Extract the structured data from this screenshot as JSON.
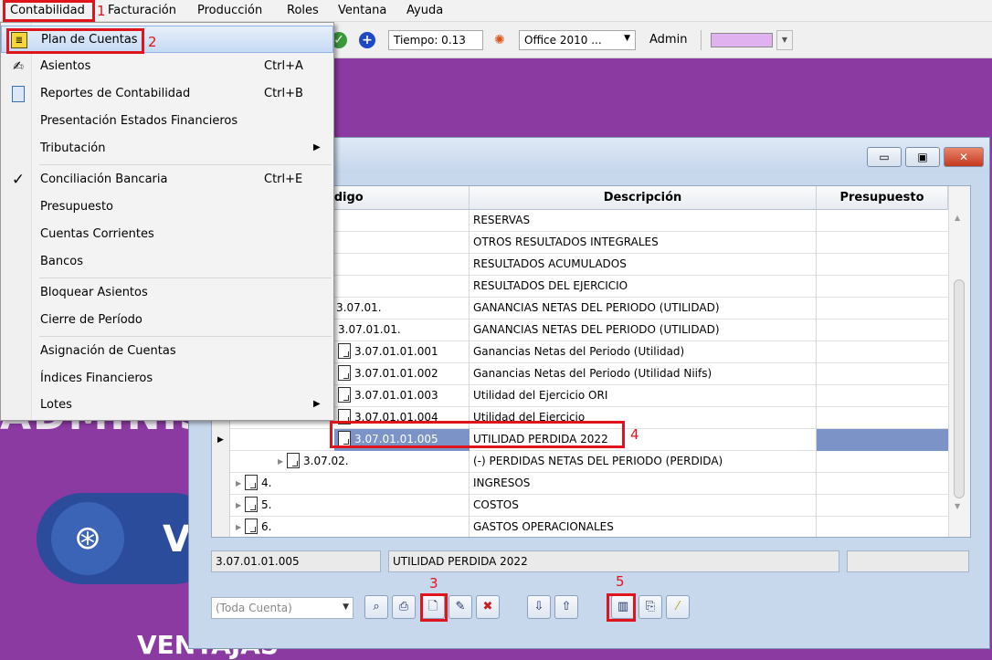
{
  "menubar": {
    "items": [
      "Contabilidad",
      "Facturación",
      "Producción",
      "Roles",
      "Ventana",
      "Ayuda"
    ]
  },
  "toolbar": {
    "tiempo": "Tiempo: 0.13",
    "theme": "Office 2010 ...",
    "user": "Admin"
  },
  "background": {
    "watermark": "ADMINIS",
    "pill_letter": "V",
    "bottom_text": "VENTAJAS"
  },
  "menu": {
    "items": [
      {
        "label": "Plan de Cuentas",
        "shortcut": "",
        "icon": "ledger-icon"
      },
      {
        "label": "Asientos",
        "shortcut": "Ctrl+A",
        "icon": "journal-icon"
      },
      {
        "label": "Reportes de Contabilidad",
        "shortcut": "Ctrl+B",
        "icon": "report-icon"
      },
      {
        "label": "Presentación Estados Financieros",
        "shortcut": ""
      },
      {
        "label": "Tributación",
        "shortcut": "",
        "submenu": true
      },
      {
        "label": "Conciliación Bancaria",
        "shortcut": "Ctrl+E",
        "checked": true
      },
      {
        "label": "Presupuesto",
        "shortcut": ""
      },
      {
        "label": "Cuentas Corrientes",
        "shortcut": ""
      },
      {
        "label": "Bancos",
        "shortcut": ""
      },
      {
        "label": "Bloquear Asientos",
        "shortcut": ""
      },
      {
        "label": "Cierre de Período",
        "shortcut": ""
      },
      {
        "label": "Asignación de Cuentas",
        "shortcut": ""
      },
      {
        "label": "Índices Financieros",
        "shortcut": ""
      },
      {
        "label": "Lotes",
        "shortcut": "",
        "submenu": true
      }
    ]
  },
  "grid": {
    "headers": [
      "Código",
      "Descripción",
      "Presupuesto"
    ],
    "rows": [
      {
        "code": "",
        "desc": "RESERVAS"
      },
      {
        "code": "",
        "desc": "OTROS RESULTADOS INTEGRALES"
      },
      {
        "code": "",
        "desc": "RESULTADOS ACUMULADOS"
      },
      {
        "code": "",
        "desc": "RESULTADOS DEL EJERCICIO"
      },
      {
        "code": "3.07.01.",
        "desc": "GANANCIAS NETAS DEL PERIODO (UTILIDAD)"
      },
      {
        "code": "3.07.01.01.",
        "desc": "GANANCIAS NETAS DEL PERIODO (UTILIDAD)"
      },
      {
        "code": "3.07.01.01.001",
        "desc": "Ganancias Netas del Periodo (Utilidad)"
      },
      {
        "code": "3.07.01.01.002",
        "desc": "Ganancias Netas del Periodo (Utilidad Niifs)"
      },
      {
        "code": "3.07.01.01.003",
        "desc": "Utilidad del Ejercicio ORI"
      },
      {
        "code": "3.07.01.01.004",
        "desc": "Utilidad del Ejercicio"
      },
      {
        "code": "3.07.01.01.005",
        "desc": "UTILIDAD PERDIDA 2022"
      },
      {
        "code": "3.07.02.",
        "desc": "(-) PERDIDAS NETAS DEL PERIODO (PERDIDA)"
      },
      {
        "code": "4.",
        "desc": "INGRESOS"
      },
      {
        "code": "5.",
        "desc": "COSTOS"
      },
      {
        "code": "6.",
        "desc": "GASTOS  OPERACIONALES"
      }
    ]
  },
  "status": {
    "code": "3.07.01.01.005",
    "desc": "UTILIDAD PERDIDA 2022",
    "extra": ""
  },
  "bottom": {
    "combo_placeholder": "(Toda Cuenta)"
  },
  "annotations": [
    "1",
    "2",
    "3",
    "4",
    "5"
  ],
  "colors": {
    "annotation_red": "#e0141c",
    "selection_blue": "#7b93c6",
    "background_purple": "#8a3aa0"
  }
}
